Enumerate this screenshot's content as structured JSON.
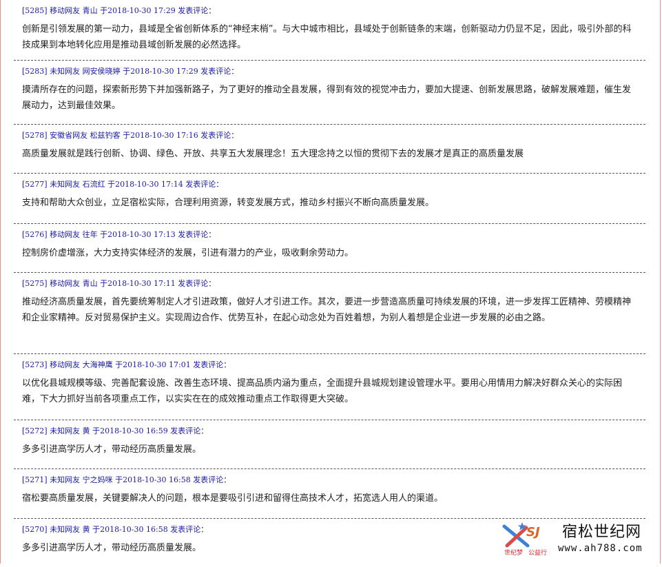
{
  "comments": [
    {
      "id": "[5285]",
      "region": "移动",
      "user_type": "网友",
      "name": "青山",
      "at": "于",
      "time": "2018-10-30 17:29",
      "action": "发表评论：",
      "text": "创新是引领发展的第一动力，县域是全省创新体系的“神经末梢”。与大中城市相比，县域处于创新链条的末端，创新驱动力仍显不足，因此，吸引外部的科技成果到本地转化应用是推动县域创新发展的必然选择。"
    },
    {
      "id": "[5283]",
      "region": "未知",
      "user_type": "网友",
      "name": "网安侯晓婷",
      "at": "于",
      "time": "2018-10-30 17:29",
      "action": "发表评论：",
      "text": "摸清所存在的问题，探索新形势下并加强新路子，为了更好的推动全县发展，得到有效的视觉冲击力，要加大提速、创新发展思路，破解发展难题，催生发展动力，达到最佳效果。"
    },
    {
      "id": "[5278]",
      "region": "安徽省",
      "user_type": "网友",
      "name": "松兹钓客",
      "at": "于",
      "time": "2018-10-30 17:16",
      "action": "发表评论：",
      "text": "高质量发展就是践行创新、协调、绿色、开放、共享五大发展理念！五大理念持之以恒的贯彻下去的发展才是真正的高质量发展"
    },
    {
      "id": "[5277]",
      "region": "未知",
      "user_type": "网友",
      "name": "石流红",
      "at": "于",
      "time": "2018-10-30 17:14",
      "action": "发表评论：",
      "text": "支持和帮助大众创业，立足宿松实际，合理利用资源，转变发展方式，推动乡村振兴不断向高质量发展。"
    },
    {
      "id": "[5276]",
      "region": "移动",
      "user_type": "网友",
      "name": "往年",
      "at": "于",
      "time": "2018-10-30 17:13",
      "action": "发表评论：",
      "text": "控制房价虚增涨，大力支持实体经济的发展，引进有潜力的产业，吸收剩余劳动力。"
    },
    {
      "id": "[5275]",
      "region": "移动",
      "user_type": "网友",
      "name": "青山",
      "at": "于",
      "time": "2018-10-30 17:11",
      "action": "发表评论：",
      "text": "推动经济高质量发展，首先要统筹制定人才引进政策，做好人才引进工作。其次，要进一步营造高质量可持续发展的环境，进一步发挥工匠精神、劳模精神和企业家精神。反对贸易保护主义。实现周边合作、优势互补，在起心动念处为百姓着想，为别人着想是企业进一步发展的必由之路。"
    },
    {
      "id": "[5273]",
      "region": "移动",
      "user_type": "网友",
      "name": "大海神鹰",
      "at": "于",
      "time": "2018-10-30 17:01",
      "action": "发表评论：",
      "text": "以优化县城规模等级、完善配套设施、改善生态环境、提高品质内涵为重点，全面提升县城规划建设管理水平。要用心用情用力解决好群众关心的实际困难，下大力抓好当前各项重点工作，以实实在在的成效推动重点工作取得更大突破。"
    },
    {
      "id": "[5272]",
      "region": "未知",
      "user_type": "网友",
      "name": "黄",
      "at": "于",
      "time": "2018-10-30 16:59",
      "action": "发表评论：",
      "text": "多多引进高学历人才，带动经历高质量发展。"
    },
    {
      "id": "[5271]",
      "region": "未知",
      "user_type": "网友",
      "name": "宁之妈咪",
      "at": "于",
      "time": "2018-10-30 16:58",
      "action": "发表评论：",
      "text": "宿松要高质量发展，关键要解决人的问题，根本是要吸引引进和留得住高技术人才，拓宽选人用人的渠道。"
    },
    {
      "id": "[5270]",
      "region": "未知",
      "user_type": "网友",
      "name": "黄",
      "at": "于",
      "time": "2018-10-30 16:58",
      "action": "发表评论：",
      "text": "多多引进高学历人才，带动经历高质量发展。"
    }
  ],
  "logo": {
    "sj": "SJ",
    "sub1": "世纪梦",
    "sub2": "公益行",
    "title": "宿松世纪网",
    "url": "www.ah788.com",
    "colors": {
      "accent": "#3f7fd6",
      "brand": "#d7672a",
      "red": "#cc2a2a"
    }
  }
}
